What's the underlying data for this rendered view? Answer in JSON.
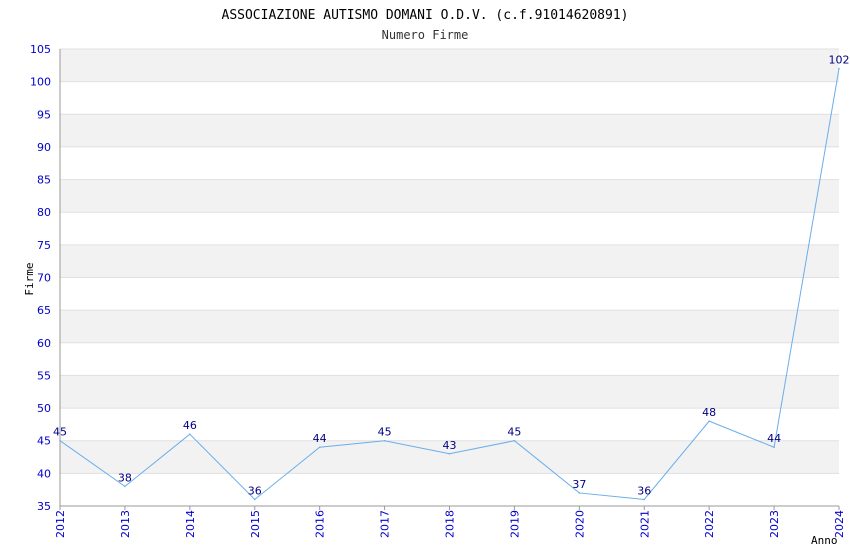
{
  "chart_data": {
    "type": "line",
    "title": "ASSOCIAZIONE AUTISMO DOMANI O.D.V. (c.f.91014620891)",
    "subtitle": "Numero Firme",
    "xlabel": "Anno",
    "ylabel": "Firme",
    "categories": [
      "2012",
      "2013",
      "2014",
      "2015",
      "2016",
      "2017",
      "2018",
      "2019",
      "2020",
      "2021",
      "2022",
      "2023",
      "2024"
    ],
    "values": [
      45,
      38,
      46,
      36,
      44,
      45,
      43,
      45,
      37,
      36,
      48,
      44,
      102
    ],
    "ylim": [
      35,
      105
    ],
    "yticks": [
      35,
      40,
      45,
      50,
      55,
      60,
      65,
      70,
      75,
      80,
      85,
      90,
      95,
      100,
      105
    ],
    "grid": "horizontal, alternating bands",
    "colors": {
      "line": "#6aaeea",
      "band": "#f2f2f2",
      "tick_text": "#0000cc",
      "data_label": "#000080"
    }
  }
}
